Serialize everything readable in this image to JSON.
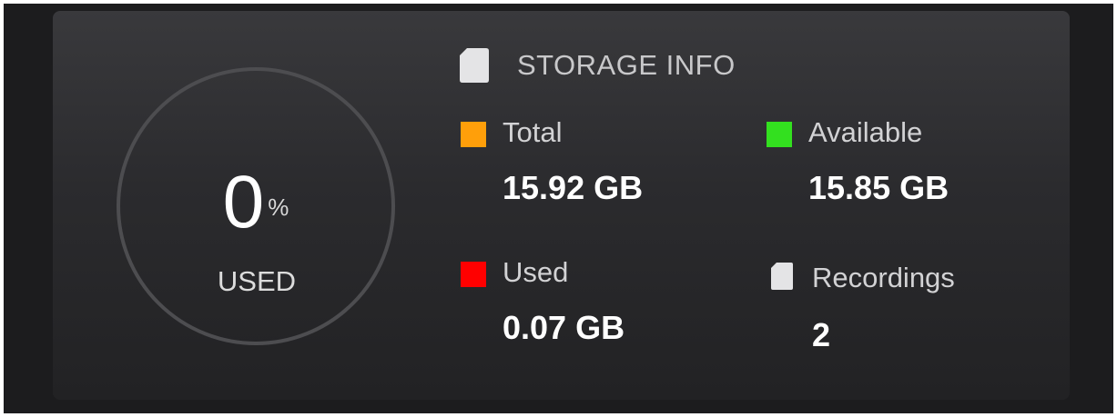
{
  "gauge": {
    "value": "0",
    "unit": "%",
    "caption": "USED",
    "fraction_used": 0
  },
  "storage": {
    "header_icon": "sd-card-icon",
    "title": "STORAGE INFO",
    "total": {
      "label": "Total",
      "value": "15.92 GB",
      "color": "#ff9f0a"
    },
    "available": {
      "label": "Available",
      "value": "15.85 GB",
      "color": "#33e01f"
    },
    "used": {
      "label": "Used",
      "value": "0.07 GB",
      "color": "#ff0000"
    },
    "recordings": {
      "icon": "sd-card-icon",
      "label": "Recordings",
      "value": "2"
    }
  },
  "colors": {
    "card_background": "#2b2b2e",
    "ring": "#4d4d50"
  }
}
